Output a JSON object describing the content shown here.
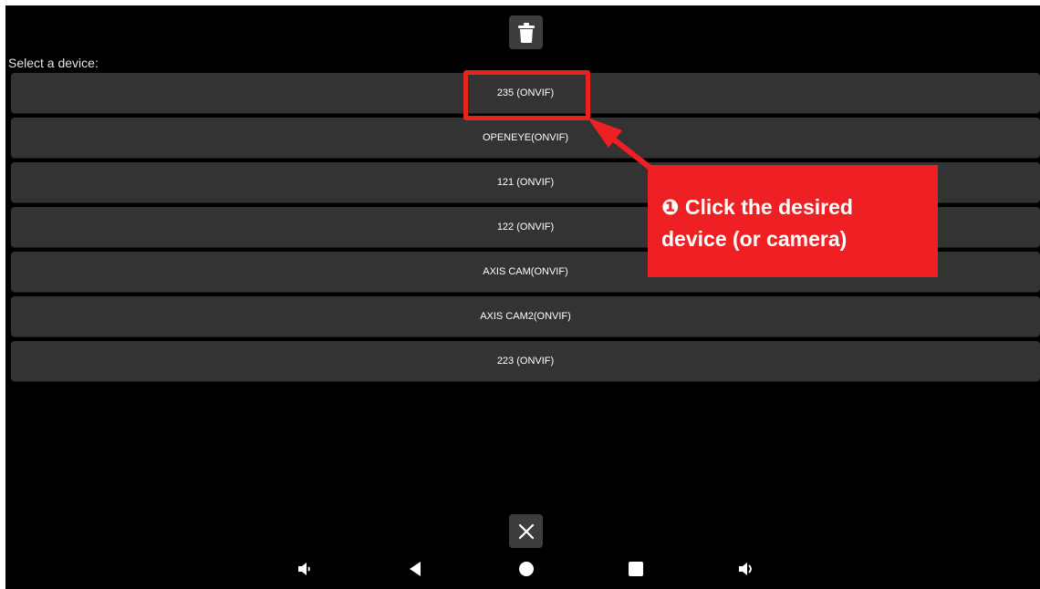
{
  "header": {
    "trash_icon": "trash-icon"
  },
  "main": {
    "select_label": "Select a device:",
    "devices": [
      {
        "label": "235 (ONVIF)"
      },
      {
        "label": "OPENEYE(ONVIF)"
      },
      {
        "label": "121 (ONVIF)"
      },
      {
        "label": "122 (ONVIF)"
      },
      {
        "label": "AXIS CAM(ONVIF)"
      },
      {
        "label": "AXIS CAM2(ONVIF)"
      },
      {
        "label": "223 (ONVIF)"
      }
    ]
  },
  "annotation": {
    "callout_text": "❶ Click the desired\ndevice (or camera)",
    "color": "#ee2024"
  },
  "footer": {
    "close_icon": "close-icon"
  },
  "navbar": {
    "icons": [
      "volume-down-icon",
      "back-icon",
      "home-icon",
      "recents-icon",
      "volume-up-icon"
    ]
  },
  "colors": {
    "background": "#000000",
    "item_bg": "#333333",
    "accent": "#e8231f"
  }
}
